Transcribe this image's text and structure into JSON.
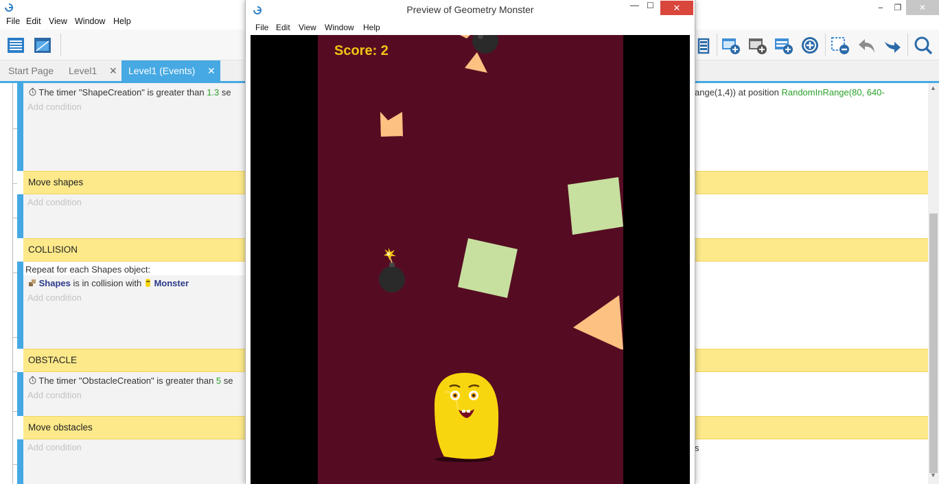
{
  "ide": {
    "menu": [
      "File",
      "Edit",
      "View",
      "Window",
      "Help"
    ],
    "tabs": {
      "start_page": "Start Page",
      "level1": "Level1",
      "level1_events": "Level1 (Events)"
    },
    "window_controls": {
      "minimize": "‒",
      "maximize": "❐",
      "close": "✕"
    }
  },
  "events": {
    "event1": {
      "cond_prefix": "The timer ",
      "timer_name": "\"ShapeCreation\"",
      "cond_mid": " is greater than ",
      "value": "1.3",
      "cond_suffix": " se",
      "action_prefix": "ange(1,4)) at position ",
      "action_green": "RandomInRange(80, 640-",
      "add_condition": "Add condition"
    },
    "comment_move_shapes": "Move shapes",
    "event2": {
      "add_condition": "Add condition"
    },
    "comment_collision": "COLLISION",
    "event3": {
      "repeat_text": "Repeat for each Shapes object:",
      "object1": "Shapes",
      "mid": " is in collision with ",
      "object2": "Monster",
      "add_condition": "Add condition"
    },
    "comment_obstacle": "OBSTACLE",
    "event4": {
      "cond_prefix": "The timer ",
      "timer_name": "\"ObstacleCreation\"",
      "cond_mid": " is greater than ",
      "value": "5",
      "cond_suffix": " se",
      "add_condition": "Add condition"
    },
    "comment_move_obstacles": "Move obstacles",
    "event5": {
      "add_condition": "Add condition",
      "action_fragment": "s"
    }
  },
  "preview": {
    "title": "Preview of Geometry Monster",
    "menu": [
      "File",
      "Edit",
      "View",
      "Window",
      "Help"
    ],
    "window_controls": {
      "minimize": "—",
      "maximize": "☐",
      "close": "✕"
    },
    "score_text": "Score: 2"
  },
  "colors": {
    "accent": "#45a8e3",
    "comment_bg": "#fde98a",
    "game_bg": "#550c22",
    "score": "#f3c316",
    "square": "#c7e0a0",
    "triangle": "#fdc182",
    "monster": "#f8d60f"
  }
}
